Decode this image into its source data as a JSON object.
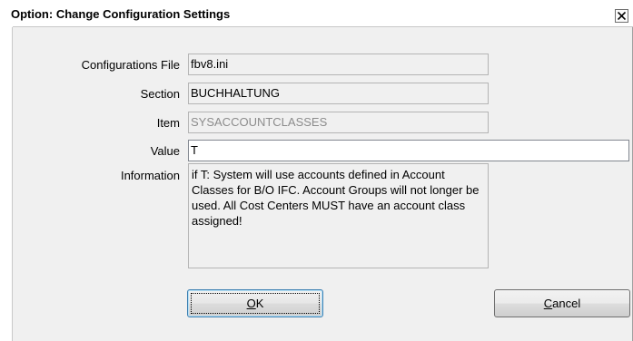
{
  "window": {
    "title": "Option: Change Configuration Settings",
    "close_icon": "close-x-icon"
  },
  "form": {
    "configurations_file": {
      "label": "Configurations File",
      "value": "fbv8.ini"
    },
    "section": {
      "label": "Section",
      "value": "BUCHHALTUNG"
    },
    "item": {
      "label": "Item",
      "value": "SYSACCOUNTCLASSES"
    },
    "value": {
      "label": "Value",
      "value": "T"
    },
    "information": {
      "label": "Information",
      "text": "if T: System will use accounts defined in Account Classes for B/O IFC. Account Groups will not longer be used. All Cost Centers MUST have an account class assigned!"
    }
  },
  "buttons": {
    "ok": {
      "mnemonic": "O",
      "rest": "K"
    },
    "cancel": {
      "mnemonic": "C",
      "rest": "ancel"
    }
  },
  "colors": {
    "dialog_background": "#f0f0f0",
    "field_border": "#b4b4b4",
    "disabled_text": "#8c8c8c",
    "default_button_border": "#3c7fb1"
  }
}
